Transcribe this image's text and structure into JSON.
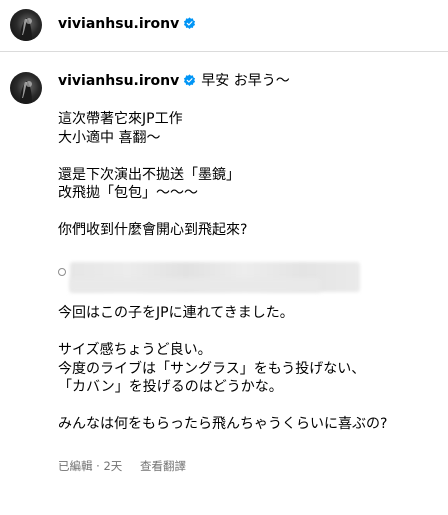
{
  "header": {
    "username": "vivianhsu.ironv"
  },
  "post": {
    "username": "vivianhsu.ironv",
    "greeting": "早安 お早う～",
    "lines": [
      "這次帶著它來JP工作",
      "大小適中 喜翻～",
      "",
      "還是下次演出不拋送「墨鏡」",
      "改飛拋「包包」～～～",
      "",
      "你們收到什麼會開心到飛起來?"
    ],
    "lines_jp": [
      "今回はこの子をJPに連れてきました。",
      "",
      "サイズ感ちょうど良い。",
      "今度のライブは「サングラス」をもう投げない、",
      "「カバン」を投げるのはどうかな。",
      "",
      "みんなは何をもらったら飛んちゃうくらいに喜ぶの?"
    ],
    "edited_label": "已編輯",
    "time": "2天",
    "separator": "·",
    "see_translation": "查看翻譯"
  },
  "colors": {
    "verified": "#0095f6",
    "meta_text": "#737373",
    "divider": "#dbdbdb"
  }
}
